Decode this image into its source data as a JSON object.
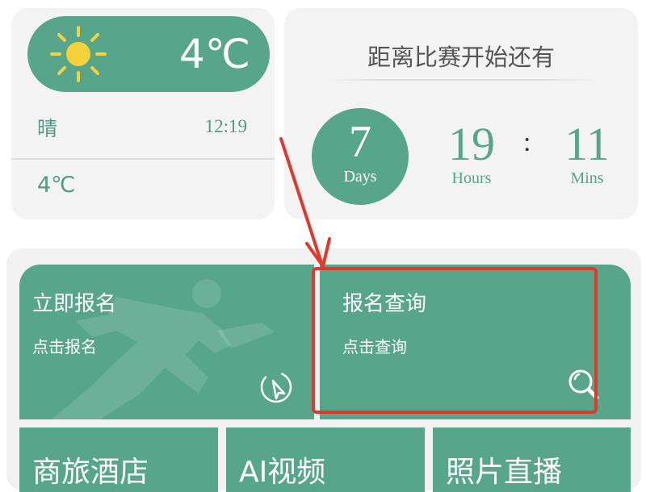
{
  "weather": {
    "icon": "sun-icon",
    "temperature_big": "4℃",
    "condition": "晴",
    "time": "12:19",
    "temperature_small": "4℃"
  },
  "countdown": {
    "title": "距离比赛开始还有",
    "days_value": "7",
    "days_label": "Days",
    "hours_value": "19",
    "hours_label": "Hours",
    "separator": ":",
    "mins_value": "11",
    "mins_label": "Mins"
  },
  "actions": {
    "register": {
      "title": "立即报名",
      "subtitle": "点击报名",
      "icon": "cursor-icon"
    },
    "query": {
      "title": "报名查询",
      "subtitle": "点击查询",
      "icon": "search-icon"
    },
    "hotel": {
      "label": "商旅酒店"
    },
    "video": {
      "label": "AI视频"
    },
    "photo": {
      "label": "照片直播"
    }
  },
  "colors": {
    "brand_green": "#57a58b",
    "annotation_red": "#e0392b",
    "sun_yellow": "#f6d23a"
  }
}
